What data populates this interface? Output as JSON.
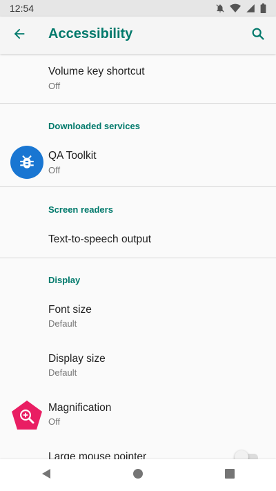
{
  "status_bar": {
    "time": "12:54"
  },
  "app_bar": {
    "title": "Accessibility"
  },
  "items": {
    "volume_key_shortcut": {
      "title": "Volume key shortcut",
      "summary": "Off"
    },
    "qa_toolkit": {
      "title": "QA Toolkit",
      "summary": "Off"
    },
    "text_to_speech": {
      "title": "Text-to-speech output"
    },
    "font_size": {
      "title": "Font size",
      "summary": "Default"
    },
    "display_size": {
      "title": "Display size",
      "summary": "Default"
    },
    "magnification": {
      "title": "Magnification",
      "summary": "Off"
    },
    "large_mouse_pointer": {
      "title": "Large mouse pointer",
      "enabled": false
    }
  },
  "sections": {
    "downloaded_services": "Downloaded services",
    "screen_readers": "Screen readers",
    "display": "Display"
  },
  "colors": {
    "accent": "#00796b",
    "qa_icon_bg": "#1976d2",
    "magnification_icon_bg": "#e91e63"
  },
  "icons": {
    "back": "arrow-left-icon",
    "search": "search-icon",
    "qa_toolkit": "bug-icon",
    "magnification": "magnifier-plus-icon"
  }
}
